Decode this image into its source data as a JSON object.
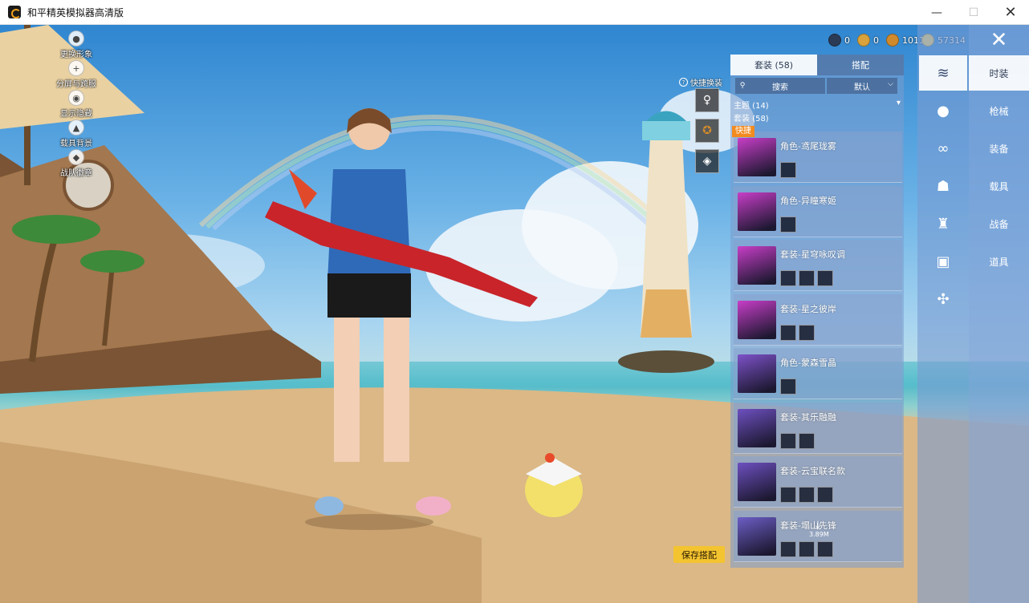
{
  "window": {
    "title": "和平精英模拟器高清版",
    "minimize": "—",
    "maximize": "☐",
    "close": "✕"
  },
  "left_menu": [
    {
      "label": "更换形象",
      "icon": "person-icon"
    },
    {
      "label": "分屏与跨服",
      "icon": "plus-icon"
    },
    {
      "label": "显示隐藏",
      "icon": "eye-icon"
    },
    {
      "label": "载具背景",
      "icon": "vehicle-icon"
    },
    {
      "label": "战队徽章",
      "icon": "badge-icon"
    }
  ],
  "currency": [
    {
      "value": "0",
      "color": "#2b3a55"
    },
    {
      "value": "0",
      "color": "#d9a23a"
    },
    {
      "value": "1011",
      "color": "#d08a2c"
    },
    {
      "value": "57314",
      "color": "#f2d36a"
    }
  ],
  "quick_change": {
    "label": "快捷换装",
    "icon": "question-circle-icon"
  },
  "save_button": "保存搭配",
  "panel": {
    "tabs": [
      {
        "label": "套装 (58)",
        "active": true
      },
      {
        "label": "搭配",
        "active": false
      }
    ],
    "search": {
      "placeholder": "搜索"
    },
    "sort": {
      "value": "默认"
    },
    "theme_header": "主题 (14)",
    "set_header": "套装 (58)",
    "quick_tag": "快捷",
    "download_size": "3.89M",
    "items": [
      {
        "name": "角色-鸢尾珑雾",
        "thumb_color": "#c83ec8",
        "subs": 1
      },
      {
        "name": "角色-异瞳寒姬",
        "thumb_color": "#c83ec8",
        "subs": 1
      },
      {
        "name": "套装-星穹咏叹调",
        "thumb_color": "#c83ec8",
        "subs": 3
      },
      {
        "name": "套装-星之彼岸",
        "thumb_color": "#c83ec8",
        "subs": 2
      },
      {
        "name": "角色-蒙森雪晶",
        "thumb_color": "#7d52c9",
        "subs": 1
      },
      {
        "name": "套装-其乐融融",
        "thumb_color": "#6d50c0",
        "subs": 2
      },
      {
        "name": "套装-云宝联名款",
        "thumb_color": "#6d50c0",
        "subs": 3
      },
      {
        "name": "套装-塌山先锋",
        "thumb_color": "#6c5ec6",
        "subs": 3
      }
    ]
  },
  "categories": [
    {
      "icon": "outfit-icon",
      "active": true
    },
    {
      "icon": "grenade-icon",
      "active": false
    },
    {
      "icon": "goggles-icon",
      "active": false
    },
    {
      "icon": "mask-icon",
      "active": false
    },
    {
      "icon": "jacket-icon",
      "active": false
    },
    {
      "icon": "backpack-icon",
      "active": false
    },
    {
      "icon": "drone-icon",
      "active": false
    }
  ],
  "side_nav": [
    {
      "label": "时装",
      "active": true
    },
    {
      "label": "枪械",
      "active": false
    },
    {
      "label": "装备",
      "active": false
    },
    {
      "label": "载具",
      "active": false
    },
    {
      "label": "战备",
      "active": false
    },
    {
      "label": "道具",
      "active": false
    }
  ],
  "side_nav_close": "✕"
}
